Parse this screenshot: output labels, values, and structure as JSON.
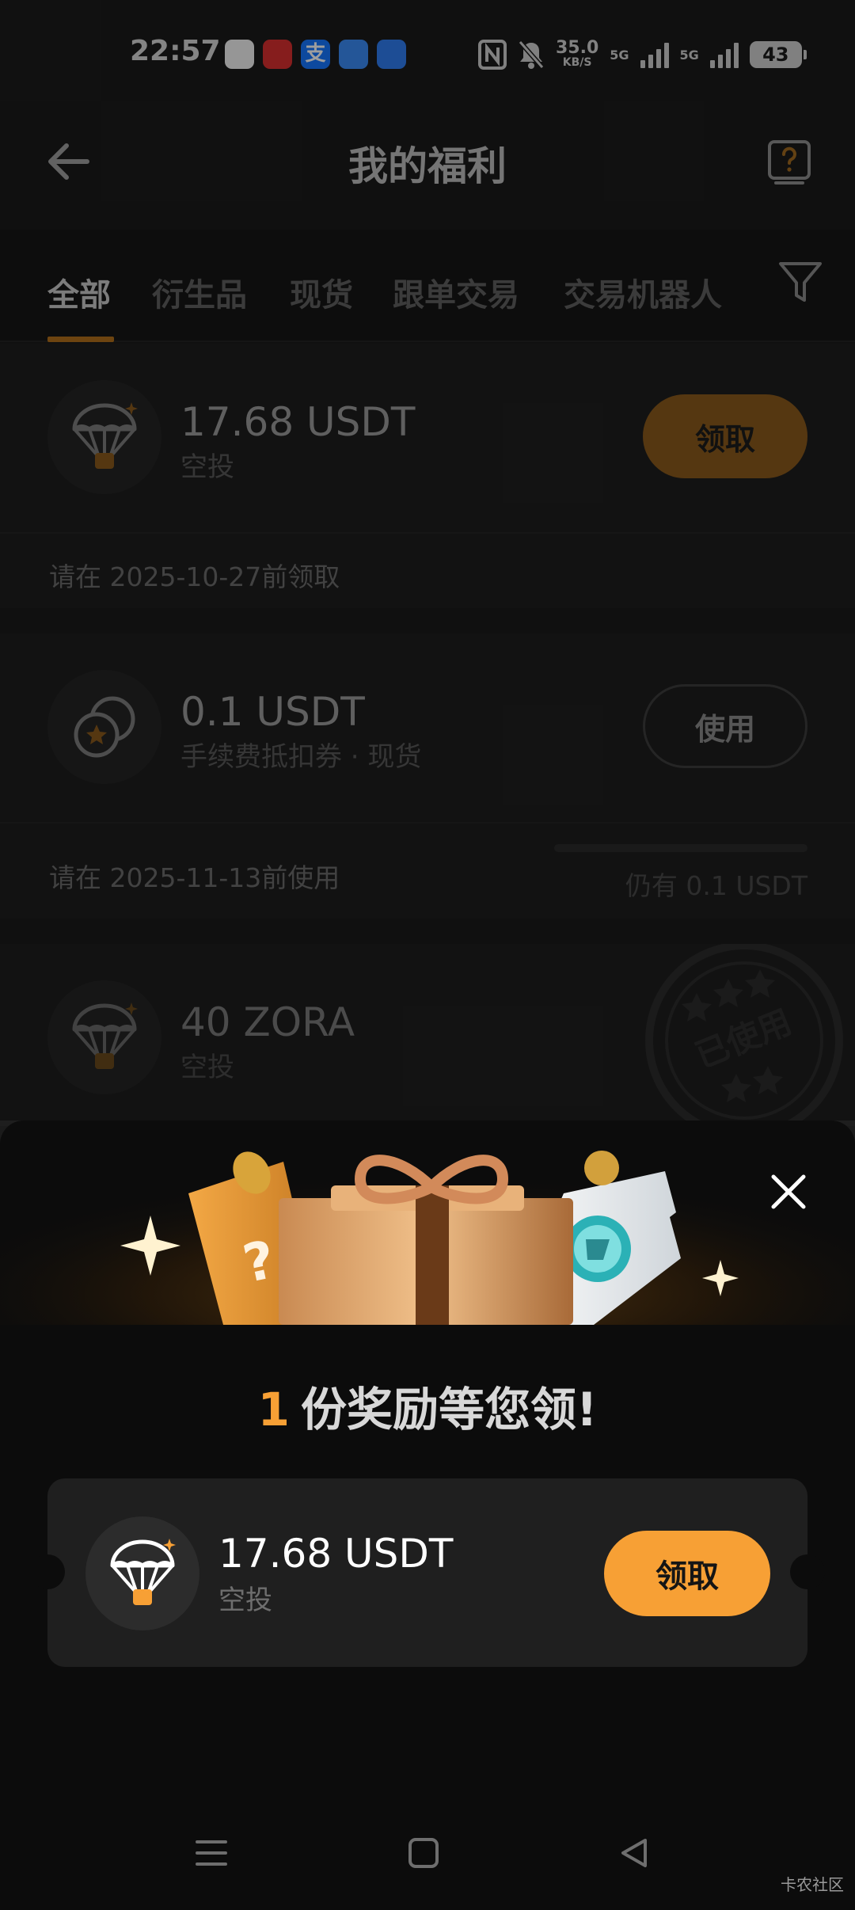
{
  "status_bar": {
    "time": "22:57",
    "net_speed": "35.0",
    "net_speed_unit": "KB/S",
    "sim1": "5G",
    "sim2": "5G",
    "battery": "43",
    "app_icon_colors": [
      "#f3f3f3",
      "#d93030",
      "#1677ff",
      "#3a8cf5",
      "#2f7df0"
    ]
  },
  "header": {
    "title": "我的福利"
  },
  "tabs": [
    {
      "label": "全部",
      "active": true
    },
    {
      "label": "衍生品",
      "active": false
    },
    {
      "label": "现货",
      "active": false
    },
    {
      "label": "跟单交易",
      "active": false
    },
    {
      "label": "交易机器人",
      "active": false
    }
  ],
  "cards": [
    {
      "amount": "17.68 USDT",
      "type": "空投",
      "icon": "parachute-icon",
      "action": "领取",
      "deadline": "请在 2025-10-27前领取"
    },
    {
      "amount": "0.1 USDT",
      "type": "手续费抵扣券 · 现货",
      "icon": "coupon-coins-icon",
      "action": "使用",
      "deadline": "请在 2025-11-13前使用",
      "remaining": "仍有 0.1 USDT",
      "remaining_fraction": 1.0
    },
    {
      "amount": "40 ZORA",
      "type": "空投",
      "icon": "parachute-icon",
      "stamp": "已使用"
    }
  ],
  "sheet": {
    "count": "1",
    "title_text": "份奖励等您领!",
    "reward": {
      "amount": "17.68 USDT",
      "type": "空投",
      "icon": "parachute-icon",
      "action": "领取"
    }
  },
  "watermark": "卡农社区",
  "colors": {
    "accent": "#f7a035",
    "accent_dim": "#8a5a1c",
    "sheet_bg": "#0c0c0c",
    "card_bg": "#1f1f1f"
  }
}
